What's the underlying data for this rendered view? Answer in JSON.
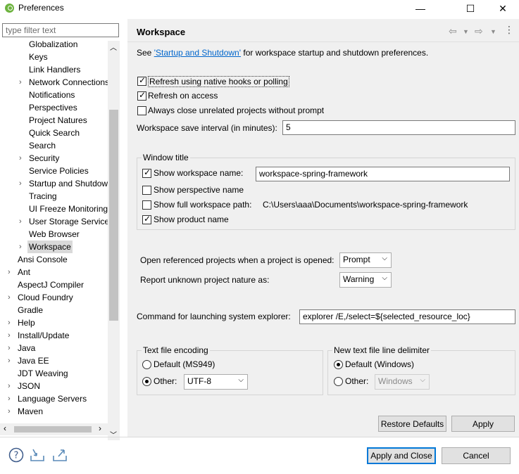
{
  "window": {
    "title": "Preferences",
    "minimize": "—",
    "maximize": "☐",
    "close": "✕"
  },
  "filter": {
    "placeholder": "type filter text"
  },
  "tree": {
    "items": [
      {
        "label": "Globalization",
        "indent": 2,
        "arrow": false
      },
      {
        "label": "Keys",
        "indent": 2,
        "arrow": false
      },
      {
        "label": "Link Handlers",
        "indent": 2,
        "arrow": false
      },
      {
        "label": "Network Connections",
        "indent": 2,
        "arrow": true
      },
      {
        "label": "Notifications",
        "indent": 2,
        "arrow": false
      },
      {
        "label": "Perspectives",
        "indent": 2,
        "arrow": false
      },
      {
        "label": "Project Natures",
        "indent": 2,
        "arrow": false
      },
      {
        "label": "Quick Search",
        "indent": 2,
        "arrow": false
      },
      {
        "label": "Search",
        "indent": 2,
        "arrow": false
      },
      {
        "label": "Security",
        "indent": 2,
        "arrow": true
      },
      {
        "label": "Service Policies",
        "indent": 2,
        "arrow": false
      },
      {
        "label": "Startup and Shutdown",
        "indent": 2,
        "arrow": true
      },
      {
        "label": "Tracing",
        "indent": 2,
        "arrow": false
      },
      {
        "label": "UI Freeze Monitoring",
        "indent": 2,
        "arrow": false
      },
      {
        "label": "User Storage Service",
        "indent": 2,
        "arrow": true
      },
      {
        "label": "Web Browser",
        "indent": 2,
        "arrow": false
      },
      {
        "label": "Workspace",
        "indent": 2,
        "arrow": true,
        "selected": true
      },
      {
        "label": "Ansi Console",
        "indent": 1,
        "arrow": false
      },
      {
        "label": "Ant",
        "indent": 1,
        "arrow": true
      },
      {
        "label": "AspectJ Compiler",
        "indent": 1,
        "arrow": false
      },
      {
        "label": "Cloud Foundry",
        "indent": 1,
        "arrow": true
      },
      {
        "label": "Gradle",
        "indent": 1,
        "arrow": false
      },
      {
        "label": "Help",
        "indent": 1,
        "arrow": true
      },
      {
        "label": "Install/Update",
        "indent": 1,
        "arrow": true
      },
      {
        "label": "Java",
        "indent": 1,
        "arrow": true
      },
      {
        "label": "Java EE",
        "indent": 1,
        "arrow": true
      },
      {
        "label": "JDT Weaving",
        "indent": 1,
        "arrow": false
      },
      {
        "label": "JSON",
        "indent": 1,
        "arrow": true
      },
      {
        "label": "Language Servers",
        "indent": 1,
        "arrow": true
      },
      {
        "label": "Maven",
        "indent": 1,
        "arrow": true
      }
    ]
  },
  "page": {
    "title": "Workspace",
    "intro_prefix": "See ",
    "intro_link": "'Startup and Shutdown'",
    "intro_suffix": " for workspace startup and shutdown preferences.",
    "refresh_native": {
      "label": "Refresh using native hooks or polling",
      "checked": true
    },
    "refresh_access": {
      "label": "Refresh on access",
      "checked": true
    },
    "always_close": {
      "label": "Always close unrelated projects without prompt",
      "checked": false
    },
    "save_interval": {
      "label": "Workspace save interval (in minutes):",
      "value": "5"
    },
    "window_title": {
      "group_label": "Window title",
      "show_workspace_name": {
        "label": "Show workspace name:",
        "checked": true,
        "value": "workspace-spring-framework"
      },
      "show_perspective_name": {
        "label": "Show perspective name",
        "checked": false
      },
      "show_full_path": {
        "label": "Show full workspace path:",
        "checked": false,
        "value": "C:\\Users\\aaa\\Documents\\workspace-spring-framework"
      },
      "show_product_name": {
        "label": "Show product name",
        "checked": true
      }
    },
    "open_referenced": {
      "label": "Open referenced projects when a project is opened:",
      "value": "Prompt"
    },
    "report_unknown": {
      "label": "Report unknown project nature as:",
      "value": "Warning"
    },
    "launch_explorer": {
      "label": "Command for launching system explorer:",
      "value": "explorer /E,/select=${selected_resource_loc}"
    },
    "encoding": {
      "group_label": "Text file encoding",
      "default_label": "Default (MS949)",
      "other_label": "Other:",
      "other_value": "UTF-8",
      "selected": "other"
    },
    "line_delimiter": {
      "group_label": "New text file line delimiter",
      "default_label": "Default (Windows)",
      "other_label": "Other:",
      "other_value": "Windows",
      "selected": "default"
    },
    "restore_defaults": "Restore Defaults",
    "apply": "Apply"
  },
  "footer": {
    "help_icon": "help-icon",
    "import_icon": "import-icon",
    "export_icon": "export-icon",
    "apply_and_close": "Apply and Close",
    "cancel": "Cancel"
  }
}
